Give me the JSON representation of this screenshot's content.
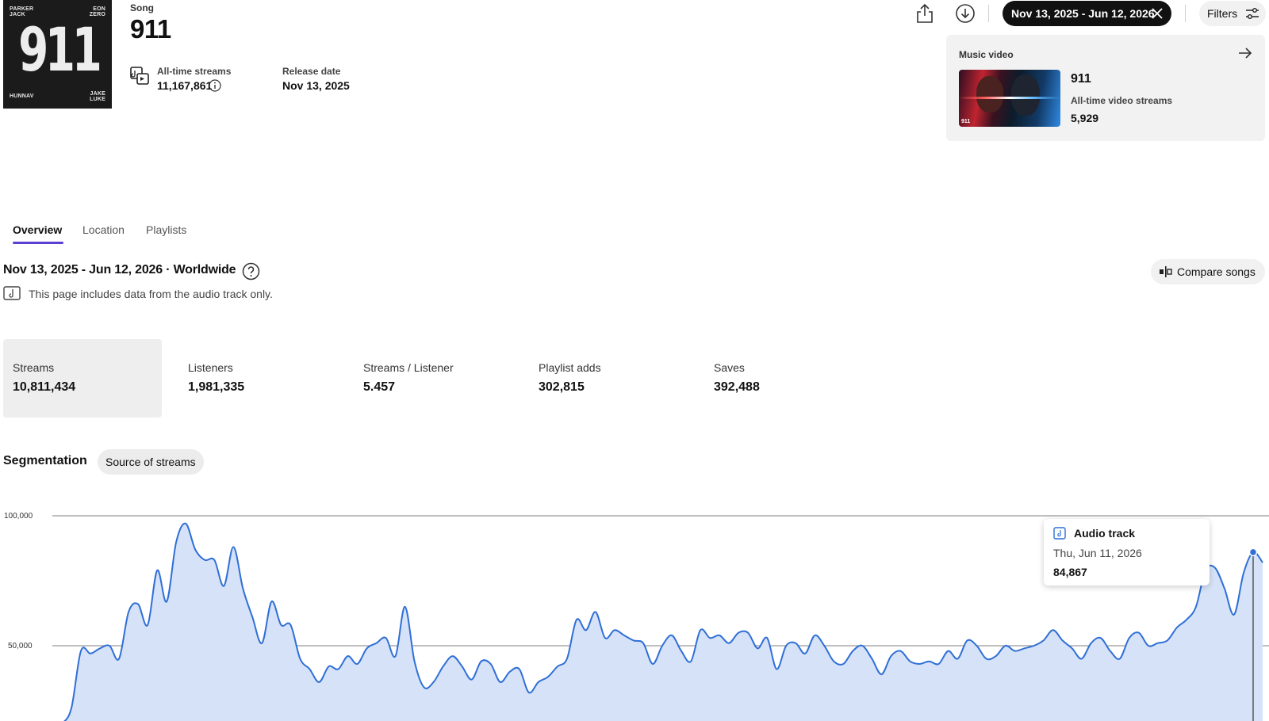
{
  "song": {
    "kicker": "Song",
    "title": "911",
    "cover": {
      "top_left": "PARKER JACK",
      "top_right": "EON ZERO",
      "center": "911",
      "bottom_left": "HUNNAV",
      "bottom_right": "JAKE LUKE"
    },
    "alltime_label": "All-time streams",
    "alltime_value": "11,167,861",
    "release_label": "Release date",
    "release_value": "Nov 13, 2025"
  },
  "toolbar": {
    "date_range": "Nov 13, 2025 - Jun 12, 2026",
    "filters_label": "Filters"
  },
  "music_video": {
    "label": "Music video",
    "title": "911",
    "streams_label": "All-time video streams",
    "streams_value": "5,929",
    "thumb_tag": "911"
  },
  "tabs": [
    "Overview",
    "Location",
    "Playlists"
  ],
  "range_title": "Nov 13, 2025 - Jun 12, 2026 · Worldwide",
  "note": "This page includes data from the audio track only.",
  "compare_label": "Compare songs",
  "kpis": [
    {
      "label": "Streams",
      "value": "10,811,434"
    },
    {
      "label": "Listeners",
      "value": "1,981,335"
    },
    {
      "label": "Streams / Listener",
      "value": "5.457"
    },
    {
      "label": "Playlist adds",
      "value": "302,815"
    },
    {
      "label": "Saves",
      "value": "392,488"
    }
  ],
  "segmentation": {
    "label": "Segmentation",
    "pill": "Source of streams"
  },
  "tooltip": {
    "title": "Audio track",
    "date": "Thu, Jun 11, 2026",
    "value": "84,867"
  },
  "colors": {
    "line": "#2f6fd6",
    "area": "#d6e2f7",
    "tab_accent": "#5b3fd1"
  },
  "chart_data": {
    "type": "area",
    "series": [
      {
        "values": [
          18000,
          20000,
          26000,
          48000,
          47000,
          49000,
          50000,
          45000,
          63000,
          66000,
          58000,
          79000,
          67000,
          90000,
          97000,
          87000,
          83000,
          83000,
          73000,
          88000,
          72000,
          61000,
          51000,
          67000,
          58000,
          58000,
          45000,
          41000,
          36000,
          42000,
          41000,
          46000,
          43000,
          49000,
          51000,
          53000,
          46000,
          65000,
          44000,
          34000,
          36000,
          42000,
          46000,
          42000,
          37000,
          44000,
          43000,
          36000,
          40000,
          41000,
          32000,
          36000,
          38000,
          42000,
          45000,
          60000,
          56000,
          63000,
          53000,
          56000,
          54000,
          52000,
          51000,
          43000,
          50000,
          54000,
          48000,
          44000,
          56000,
          53000,
          54000,
          51000,
          55000,
          55000,
          49000,
          53000,
          41000,
          50000,
          51000,
          47000,
          54000,
          50000,
          44000,
          43000,
          48000,
          50000,
          45000,
          39000,
          46000,
          48000,
          44000,
          43000,
          44000,
          43000,
          48000,
          45000,
          52000,
          50000,
          45000,
          46000,
          50000,
          48000,
          49000,
          50000,
          52000,
          56000,
          52000,
          49000,
          45000,
          51000,
          53000,
          48000,
          45000,
          53000,
          55000,
          50000,
          51000,
          52000,
          57000,
          60000,
          65000,
          79000,
          80000,
          72000,
          62000,
          78000,
          86000,
          82000
        ]
      }
    ],
    "ylim": [
      0,
      100000
    ],
    "yticks": [
      "100,000",
      "50,000"
    ]
  }
}
